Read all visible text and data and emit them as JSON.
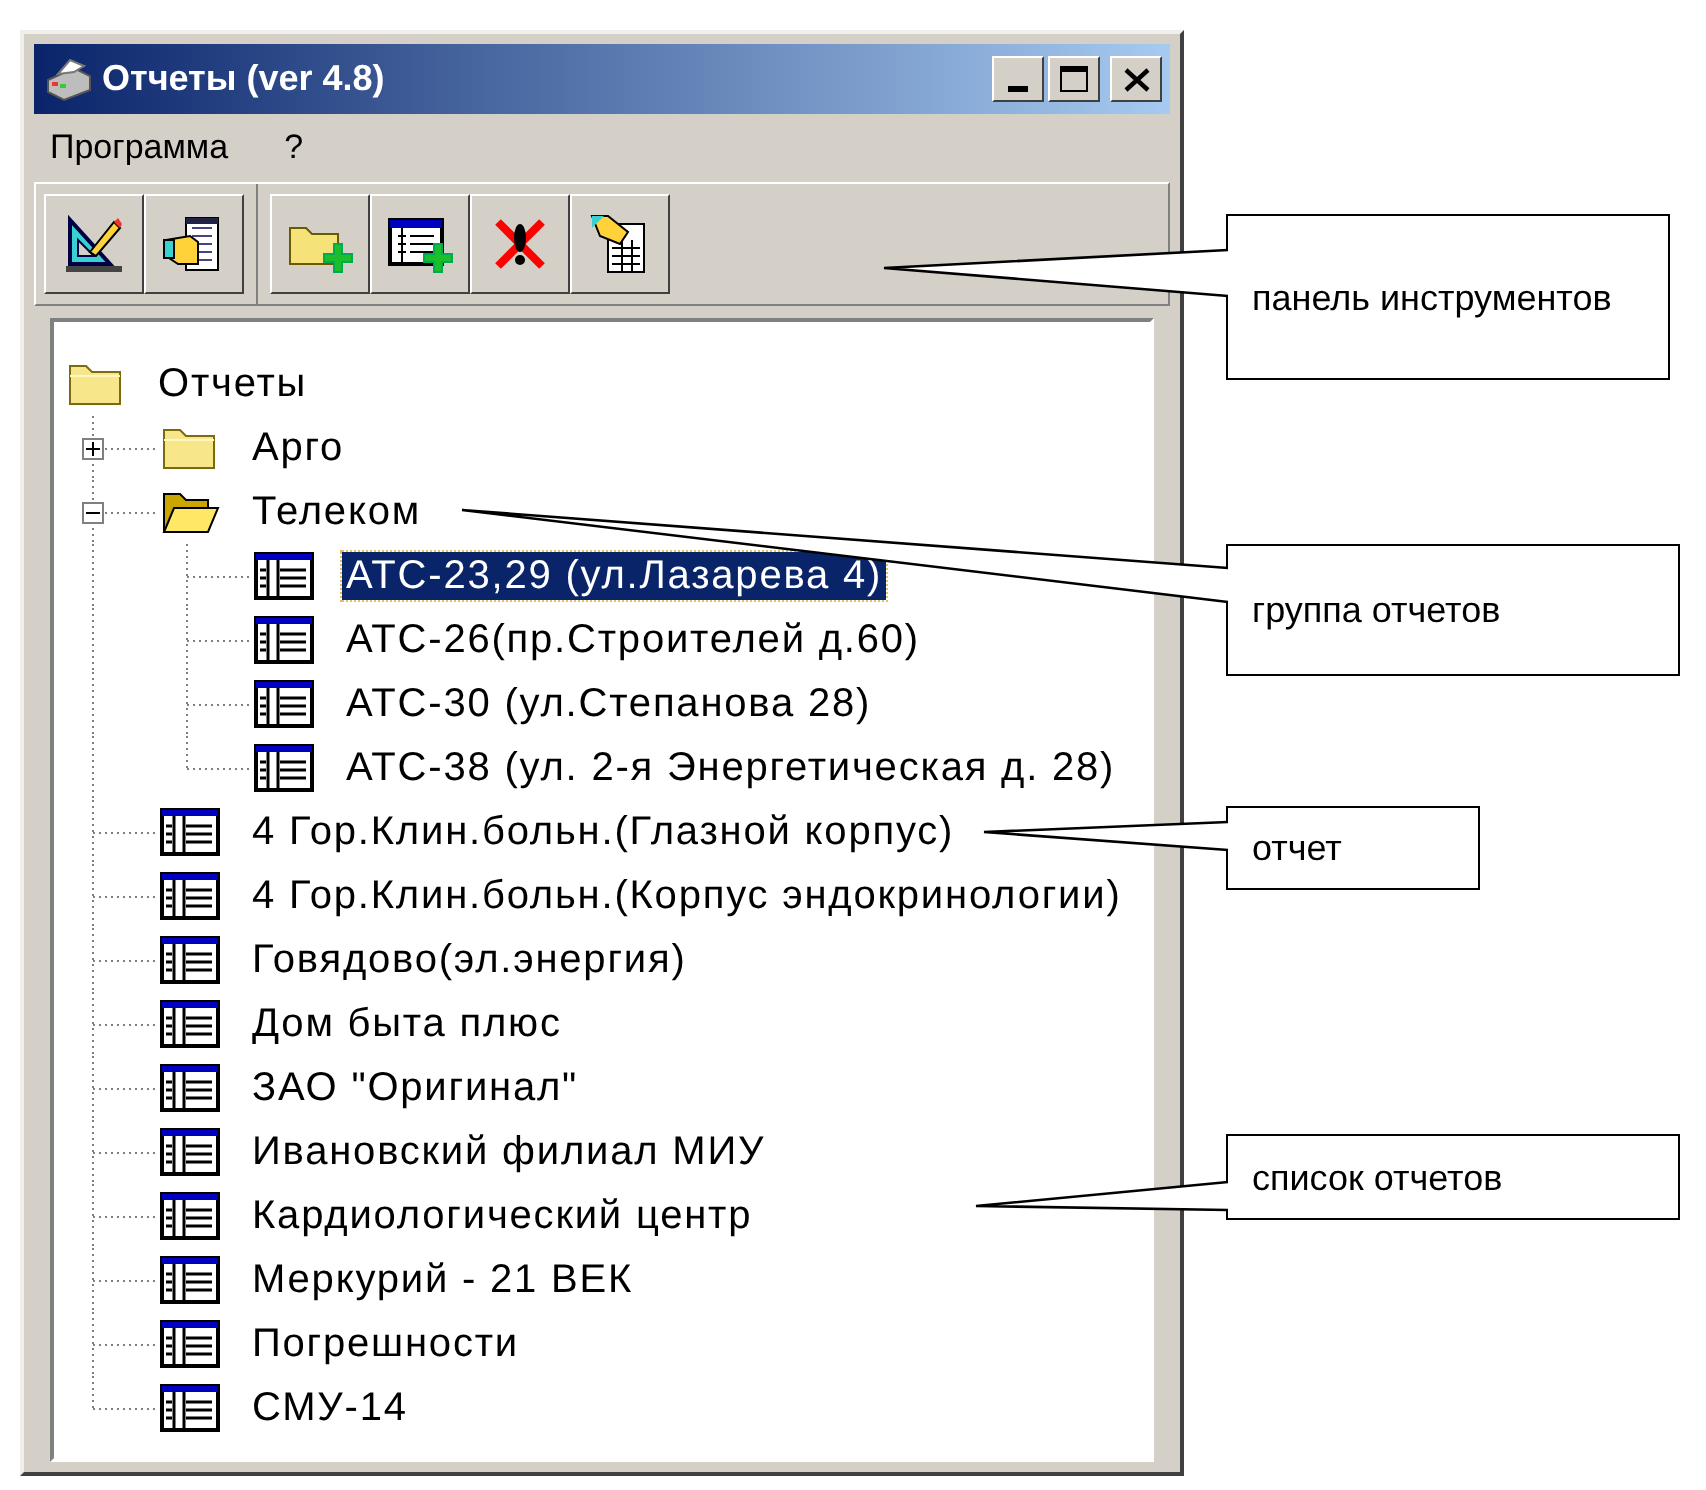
{
  "window": {
    "title": "Отчеты (ver 4.8)"
  },
  "menu": [
    {
      "label": "Программа"
    },
    {
      "label": "?"
    }
  ],
  "tree": {
    "label": "Отчеты",
    "kind": "folder",
    "selected": false,
    "children": [
      {
        "label": "Арго",
        "kind": "folder",
        "expanded": false,
        "selected": false
      },
      {
        "label": "Телеком",
        "kind": "folder",
        "expanded": true,
        "selected": false,
        "children": [
          {
            "label": "АТС-23,29 (ул.Лазарева 4)",
            "kind": "report",
            "selected": true
          },
          {
            "label": "АТС-26(пр.Строителей д.60)",
            "kind": "report",
            "selected": false
          },
          {
            "label": "АТС-30 (ул.Степанова 28)",
            "kind": "report",
            "selected": false
          },
          {
            "label": "АТС-38 (ул. 2-я Энергетическая д. 28)",
            "kind": "report",
            "selected": false
          }
        ]
      },
      {
        "label": "4 Гор.Клин.больн.(Глазной корпус)",
        "kind": "report",
        "selected": false
      },
      {
        "label": "4 Гор.Клин.больн.(Корпус эндокринологии)",
        "kind": "report",
        "selected": false
      },
      {
        "label": "Говядово(эл.энергия)",
        "kind": "report",
        "selected": false
      },
      {
        "label": "Дом быта плюс",
        "kind": "report",
        "selected": false
      },
      {
        "label": "ЗАО \"Оригинал\"",
        "kind": "report",
        "selected": false
      },
      {
        "label": "Ивановский филиал МИУ",
        "kind": "report",
        "selected": false
      },
      {
        "label": "Кардиологический центр",
        "kind": "report",
        "selected": false
      },
      {
        "label": "Меркурий - 21 ВЕК",
        "kind": "report",
        "selected": false
      },
      {
        "label": "Погрешности",
        "kind": "report",
        "selected": false
      },
      {
        "label": "СМУ-14",
        "kind": "report",
        "selected": false
      }
    ]
  },
  "callouts": [
    {
      "text": "панель инструментов"
    },
    {
      "text": "группа отчетов"
    },
    {
      "text": "отчет"
    },
    {
      "text": "список отчетов"
    }
  ]
}
